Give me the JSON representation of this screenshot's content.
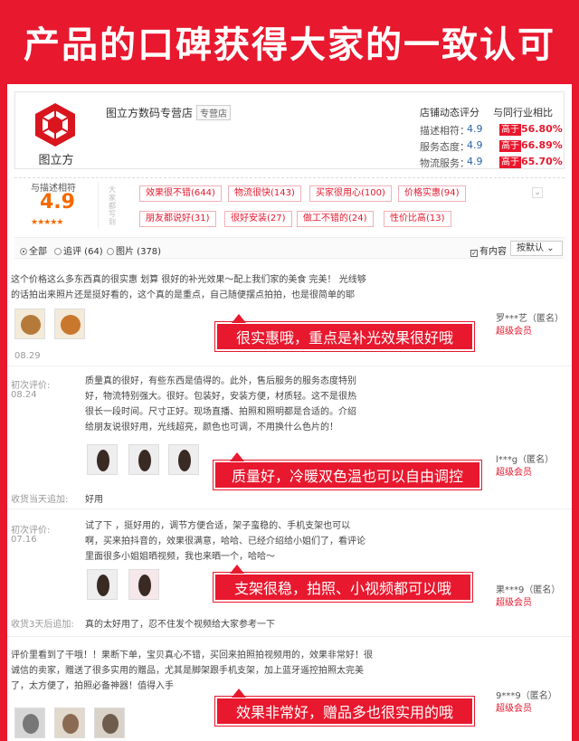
{
  "banner": {
    "title": "产品的口碑获得大家的一致认可"
  },
  "shop": {
    "logo_text": "图立方",
    "name": "图立方数码专营店",
    "tag": "专营店",
    "rating_header": "店铺动态评分",
    "compare_header": "与同行业相比",
    "ratings": [
      {
        "label": "描述相符：",
        "value": "4.9",
        "badge": "高于",
        "percent": "56.80%"
      },
      {
        "label": "服务态度：",
        "value": "4.9",
        "badge": "高于",
        "percent": "66.89%"
      },
      {
        "label": "物流服务：",
        "value": "4.9",
        "badge": "高于",
        "percent": "65.70%"
      }
    ]
  },
  "summary": {
    "label": "与描述相符",
    "score": "4.9",
    "stars": "★★★★★",
    "side_label": "大家都写到",
    "tags": [
      "效果很不错(644)",
      "物流很快(143)",
      "买家很用心(100)",
      "价格实惠(94)",
      "朋友都说好(31)",
      "很好安装(27)",
      "做工不错的(24)",
      "性价比高(13)"
    ]
  },
  "filter": {
    "all": "全部",
    "append": "追评 (64)",
    "image": "图片 (378)",
    "has_content": "有内容",
    "sort": "按默认"
  },
  "reviews": [
    {
      "text": "这个价格这么多东西真的很实惠 划算 很好的补光效果～配上我们家的美食 完美！ 光线够的话拍出来照片还是挺好看的，这个真的是重点，自己随便摆点拍拍，也是很简单的耶",
      "date": "08.29",
      "user": "罗***艺（匿名）",
      "level": "超级会员",
      "callout": "很实惠哦，重点是补光效果很好哦"
    },
    {
      "first_label": "初次评价:",
      "date": "08.24",
      "text": "质量真的很好，有些东西是值得的。此外，售后服务的服务态度特别好，物流特别强大。很好。包装好，安装方便，材质轻。这不是很热很长一段时间。尺寸正好。现场直播、拍照和照明都是合适的。介绍给朋友说很好用，光线超亮，颜色也可调，不用换什么色片的！",
      "user": "l***g（匿名）",
      "level": "超级会员",
      "callout": "质量好，冷暖双色温也可以自由调控",
      "append_label": "收货当天追加:",
      "append_text": "好用"
    },
    {
      "first_label": "初次评价:",
      "date": "07.16",
      "text": "试了下 ，挺好用的，调节方便合适，架子蛮稳的、手机支架也可以啊，买来拍抖音的，效果很满意，哈哈、已经介绍给小姐们了，看评论里面很多小姐姐晒视频，我也来晒一个，哈哈～",
      "user": "果***9（匿名）",
      "level": "超级会员",
      "callout": "支架很稳，拍照、小视频都可以哦",
      "append_label": "收货3天后追加:",
      "append_text": "真的太好用了，忍不住发个视频给大家参考一下"
    },
    {
      "text": "评价里看到了干哦！！果断下单，宝贝真心不错，买回来拍照拍视频用的，效果非常好！很诚信的卖家，赠送了很多实用的赠品，尤其是脚架跟手机支架，加上蓝牙遥控拍照太完美了，太方便了，拍照必备神器！值得入手",
      "user": "9***9（匿名）",
      "level": "超级会员",
      "callout": "效果非常好，赠品多也很实用的哦"
    }
  ]
}
